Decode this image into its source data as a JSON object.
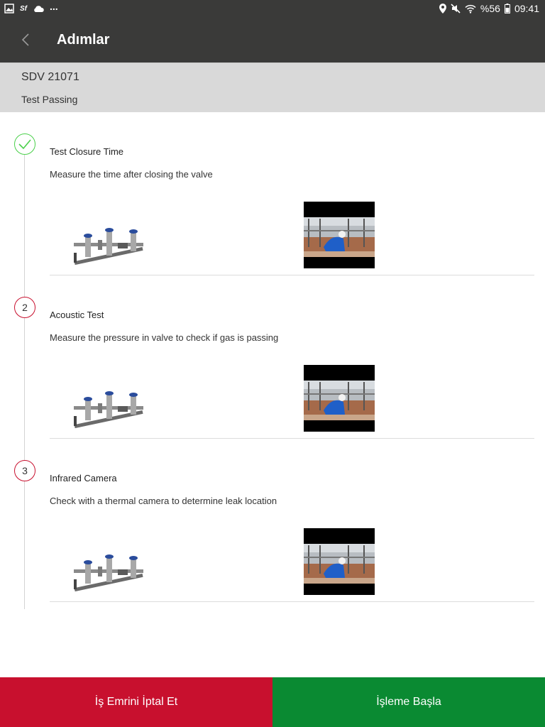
{
  "status_bar": {
    "icons_left": [
      "gallery-icon",
      "sf-icon",
      "cloud-icon",
      "more-dots-icon"
    ],
    "more_dots": "...",
    "sf": "Sf",
    "battery_text": "%56",
    "time": "09:41"
  },
  "app_bar": {
    "title": "Adımlar"
  },
  "work_order": {
    "code": "SDV 21071",
    "status": "Test Passing"
  },
  "steps": [
    {
      "marker": "",
      "done": true,
      "title": "Test Closure Time",
      "description": "Measure the time after closing the valve"
    },
    {
      "marker": "2",
      "done": false,
      "title": "Acoustic Test",
      "description": "Measure the pressure in valve to check if gas is passing"
    },
    {
      "marker": "3",
      "done": false,
      "title": "Infrared Camera",
      "description": "Check with a thermal camera to determine leak location"
    }
  ],
  "buttons": {
    "cancel": "İş Emrini İptal Et",
    "start": "İşleme Başla"
  },
  "colors": {
    "app_bar": "#3a3a39",
    "sub_header": "#d9d9d9",
    "cancel": "#c8102e",
    "start": "#0a8a32",
    "done_marker": "#4ad04a",
    "pending_marker": "#c8102e"
  }
}
